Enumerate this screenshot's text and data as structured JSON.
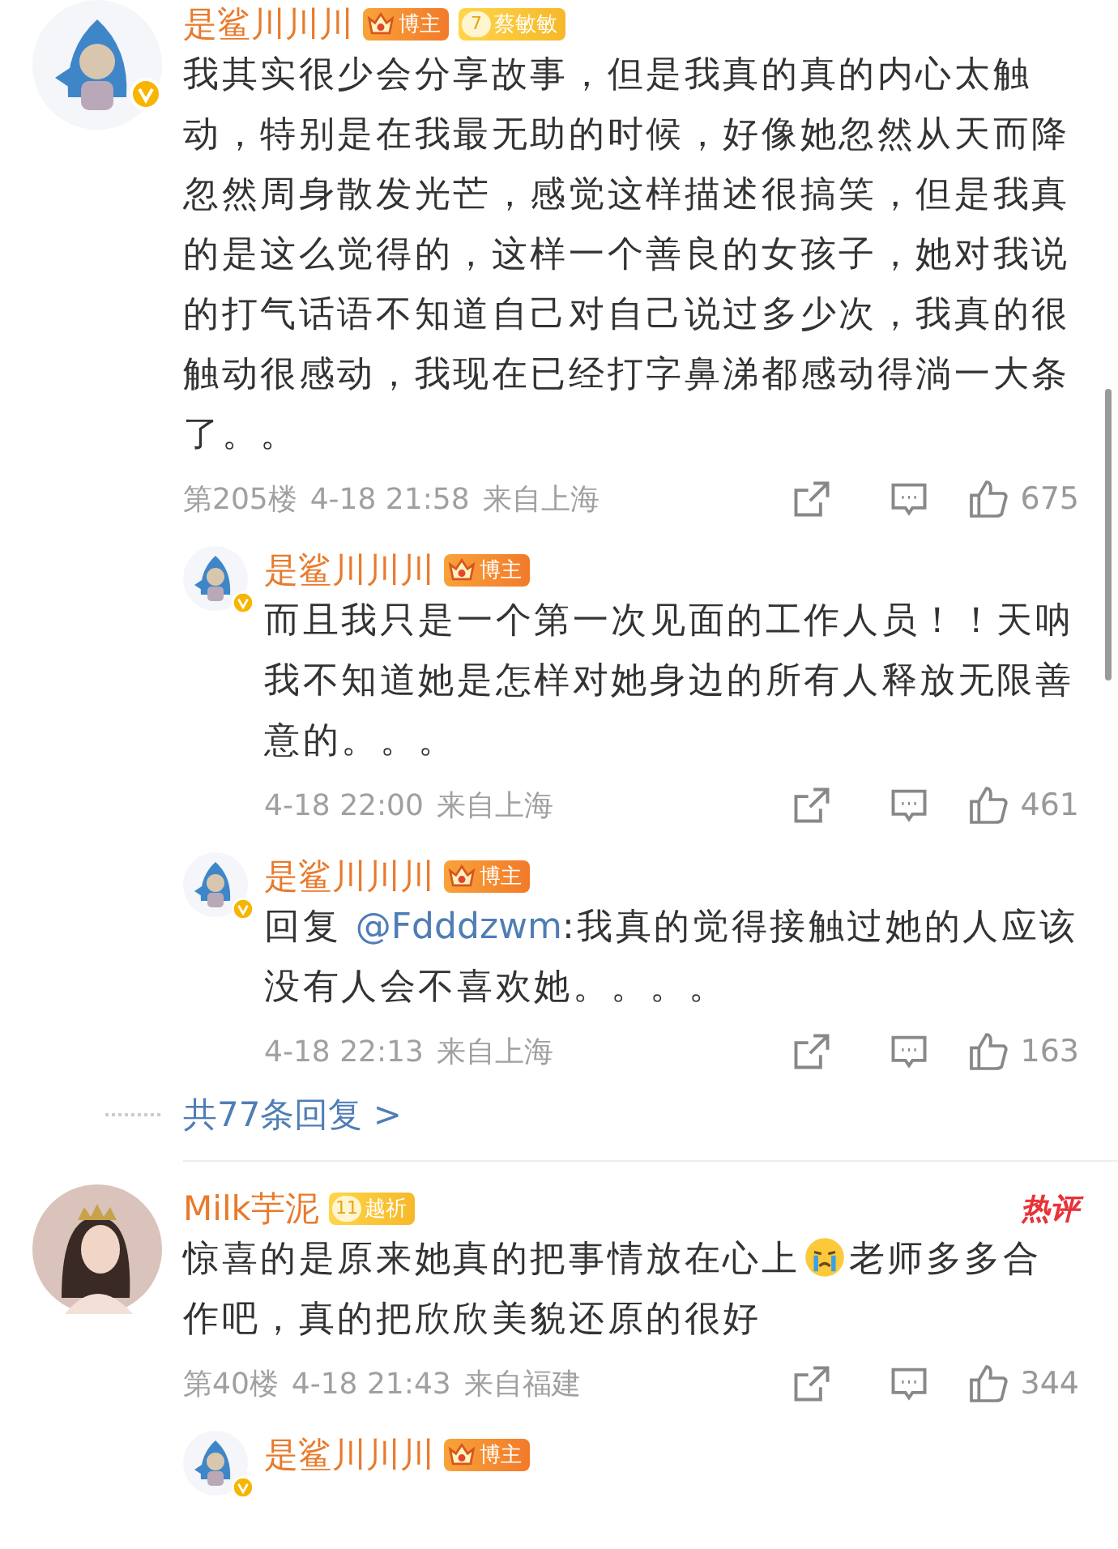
{
  "comments": [
    {
      "author": "是鲨川川川",
      "verified": true,
      "hot": false,
      "badges": [
        {
          "kind": "blogger",
          "label": "博主"
        },
        {
          "kind": "fan",
          "level": "7",
          "label": "蔡敏敏"
        }
      ],
      "segments": [
        {
          "kind": "text",
          "text": "我其实很少会分享故事，但是我真的真的内心太触动，特别是在我最无助的时候，好像她忽然从天而降忽然周身散发光芒，感觉这样描述很搞笑，但是我真的是这么觉得的，这样一个善良的女孩子，她对我说的打气话语不知道自己对自己说过多少次，我真的很触动很感动，我现在已经打字鼻涕都感动得淌一大条了。。"
        }
      ],
      "floor": "第205楼",
      "time": "4-18 21:58",
      "location": "来自上海",
      "likes": "675",
      "replies": [
        {
          "author": "是鲨川川川",
          "badges": [
            {
              "kind": "blogger",
              "label": "博主"
            }
          ],
          "segments": [
            {
              "kind": "text",
              "text": "而且我只是一个第一次见面的工作人员！！天呐我不知道她是怎样对她身边的所有人释放无限善意的。。。"
            }
          ],
          "time": "4-18 22:00",
          "location": "来自上海",
          "likes": "461"
        },
        {
          "author": "是鲨川川川",
          "badges": [
            {
              "kind": "blogger",
              "label": "博主"
            }
          ],
          "segments": [
            {
              "kind": "text",
              "text": "回复 "
            },
            {
              "kind": "mention",
              "text": "@Fdddzwm"
            },
            {
              "kind": "text",
              "text": ":我真的觉得接触过她的人应该没有人会不喜欢她。。。。"
            }
          ],
          "time": "4-18 22:13",
          "location": "来自上海",
          "likes": "163"
        }
      ],
      "more_replies": "共77条回复 >"
    },
    {
      "author": "Milk芋泥",
      "verified": false,
      "hot": true,
      "hot_label": "热评",
      "badges": [
        {
          "kind": "fan",
          "level": "11",
          "label": "越祈"
        }
      ],
      "segments": [
        {
          "kind": "text",
          "text": "惊喜的是原来她真的把事情放在心上"
        },
        {
          "kind": "emoji"
        },
        {
          "kind": "text",
          "text": "老师多多合作吧，真的把欣欣美貌还原的很好"
        }
      ],
      "floor": "第40楼",
      "time": "4-18 21:43",
      "location": "来自福建",
      "likes": "344",
      "replies": [
        {
          "author": "是鲨川川川",
          "badges": [
            {
              "kind": "blogger",
              "label": "博主"
            }
          ]
        }
      ]
    }
  ]
}
